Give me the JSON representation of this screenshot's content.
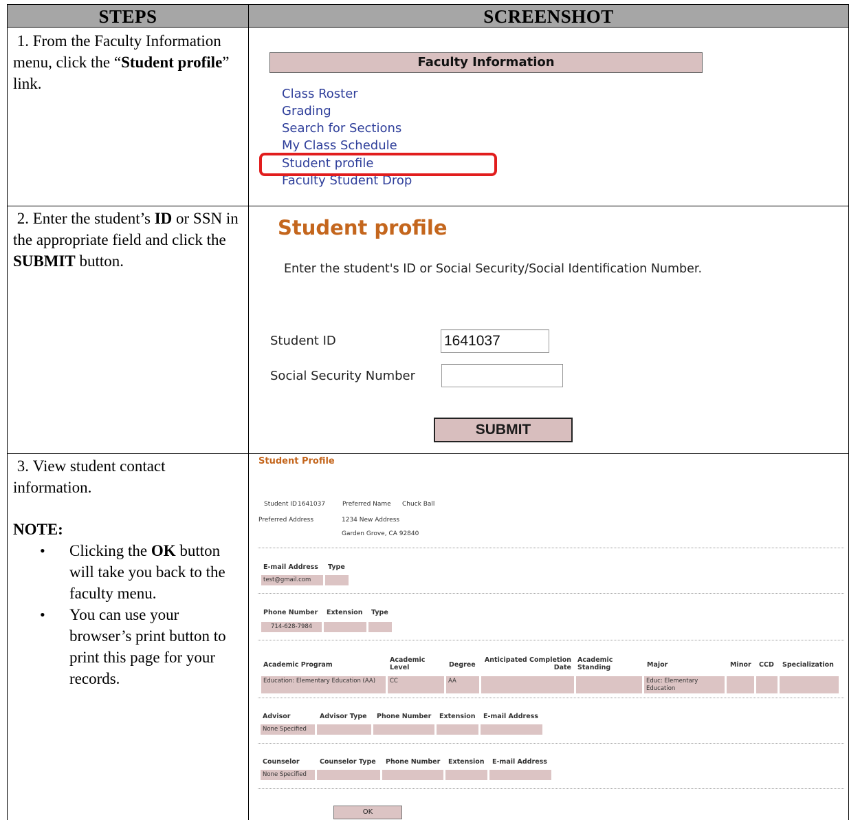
{
  "table": {
    "header_steps": "STEPS",
    "header_screenshot": "SCREENSHOT"
  },
  "step1": {
    "number": "1.",
    "text_before": "From the Faculty Information menu, click the “",
    "bold": "Student profile",
    "text_after": "” link."
  },
  "step2": {
    "number": "2.",
    "t1": "Enter the student’s ",
    "b1": "ID",
    "t2": " or SSN in the appropriate field and click the ",
    "b2": "SUBMIT",
    "t3": " button."
  },
  "step3": {
    "number": "3.",
    "text": "View student contact information.",
    "note_title": "NOTE:",
    "bullet1_before": "Clicking the ",
    "bullet1_bold": "OK",
    "bullet1_after": " button will take you back to the faculty menu.",
    "bullet2": "You can use your browser’s print button to print this page for your records."
  },
  "faculty_menu": {
    "title": "Faculty Information",
    "links": [
      "Class Roster",
      "Grading",
      "Search for Sections",
      "My Class Schedule",
      "Student profile",
      "Faculty Student Drop"
    ],
    "highlight_color": "#e11d1d"
  },
  "entry_form": {
    "title": "Student profile",
    "instruction": "Enter the student's ID or Social Security/Social Identification Number.",
    "student_id_label": "Student ID",
    "student_id_value": "1641037",
    "ssn_label": "Social Security Number",
    "ssn_value": "",
    "submit_label": "SUBMIT"
  },
  "profile": {
    "title": "Student Profile",
    "student_id_label": "Student ID",
    "student_id": "1641037",
    "preferred_name_label": "Preferred Name",
    "preferred_name": "Chuck Ball",
    "preferred_address_label": "Preferred Address",
    "address_line1": "1234 New Address",
    "address_line2": "Garden Grove, CA 92840",
    "email_headers": [
      "E-mail Address",
      "Type"
    ],
    "email_row": [
      "test@gmail.com",
      ""
    ],
    "phone_headers": [
      "Phone Number",
      "Extension",
      "Type"
    ],
    "phone_row": [
      "714-628-7984",
      "",
      ""
    ],
    "program_headers": [
      "Academic Program",
      "Academic Level",
      "Degree",
      "Anticipated Completion Date",
      "Academic Standing",
      "Major",
      "Minor",
      "CCD",
      "Specialization"
    ],
    "program_row": [
      "Education: Elementary Education (AA)",
      "CC",
      "AA",
      "",
      "",
      "Educ: Elementary Education",
      "",
      "",
      ""
    ],
    "advisor_headers": [
      "Advisor",
      "Advisor Type",
      "Phone Number",
      "Extension",
      "E-mail Address"
    ],
    "advisor_row": [
      "None Specified",
      "",
      "",
      "",
      ""
    ],
    "counselor_headers": [
      "Counselor",
      "Counselor Type",
      "Phone Number",
      "Extension",
      "E-mail Address"
    ],
    "counselor_row": [
      "None Specified",
      "",
      "",
      "",
      ""
    ],
    "ok_label": "OK",
    "cell_color": "#dcc4c4",
    "title_color": "#c4661d"
  }
}
